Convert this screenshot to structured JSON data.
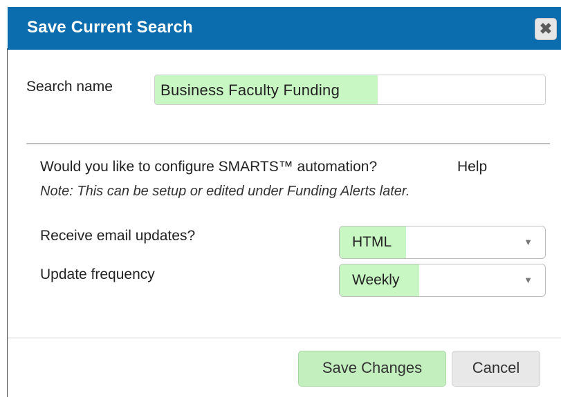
{
  "dialog": {
    "title": "Save Current Search",
    "close_icon": "close-icon",
    "close_glyph": "✖"
  },
  "search_name": {
    "label": "Search name",
    "value": "Business Faculty Funding"
  },
  "automation": {
    "question": "Would you like to configure SMARTS™ automation?",
    "help_label": "Help",
    "note": "Note: This can be setup or edited under Funding Alerts later."
  },
  "email_updates": {
    "label": "Receive email updates?",
    "selected": "HTML"
  },
  "frequency": {
    "label": "Update frequency",
    "selected": "Weekly"
  },
  "footer": {
    "save_label": "Save Changes",
    "cancel_label": "Cancel"
  },
  "colors": {
    "titlebar": "#0b6dae",
    "highlight": "#c9f7c3"
  }
}
